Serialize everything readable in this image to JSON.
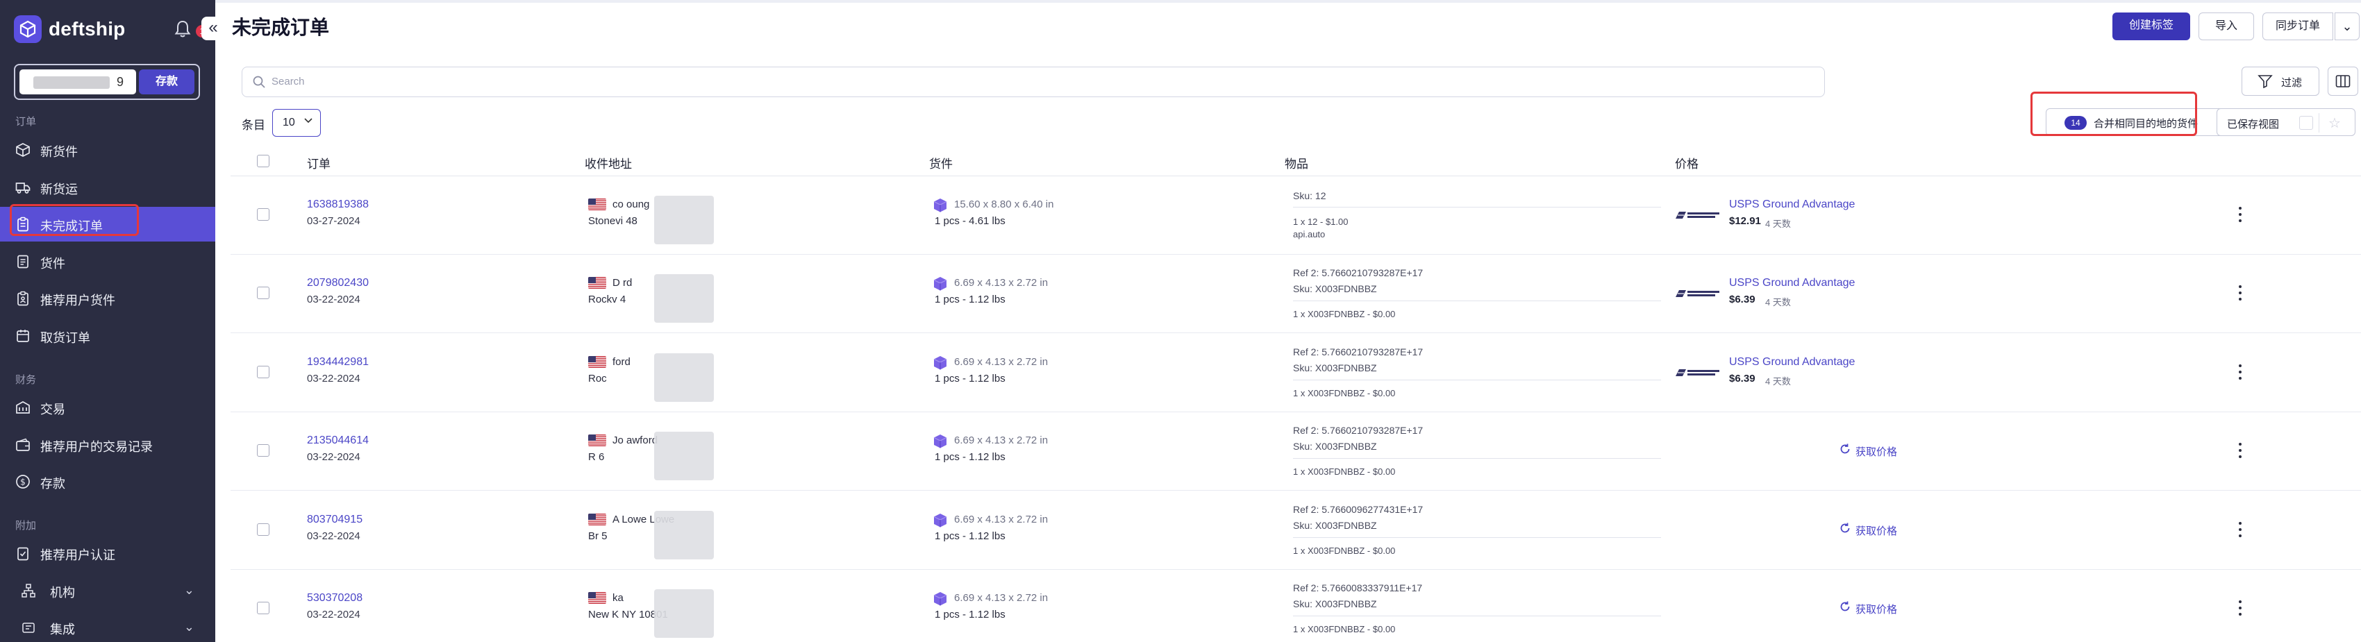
{
  "sidebar": {
    "logo_text": "deftship",
    "notification_count": "13",
    "collapse_glyph": "«",
    "balance_suffix": "9",
    "deposit_label": "存款",
    "section_orders": "订单",
    "section_finance": "财务",
    "section_extra": "附加",
    "items": [
      {
        "label": "新货件",
        "icon": "box-icon"
      },
      {
        "label": "新货运",
        "icon": "truck-icon"
      },
      {
        "label": "未完成订单",
        "icon": "clipboard-icon",
        "active": true
      },
      {
        "label": "货件",
        "icon": "document-icon"
      },
      {
        "label": "推荐用户货件",
        "icon": "clipboard-user-icon"
      },
      {
        "label": "取货订单",
        "icon": "pickup-icon"
      },
      {
        "label": "交易",
        "icon": "exchange-icon"
      },
      {
        "label": "推荐用户的交易记录",
        "icon": "wallet-icon"
      },
      {
        "label": "存款",
        "icon": "dollar-circle-icon"
      },
      {
        "label": "推荐用户认证",
        "icon": "badge-icon"
      },
      {
        "label": "机构",
        "icon": "organization-icon",
        "chevron": "⌄"
      },
      {
        "label": "集成",
        "icon": "integration-icon",
        "chevron": "⌄"
      }
    ]
  },
  "header": {
    "title": "未完成订单",
    "create_label": "创建标签",
    "import_label": "导入",
    "sync_label": "同步订单",
    "more_glyph": "⌄"
  },
  "toolbar": {
    "search_placeholder": "Search",
    "filter_label": "过滤",
    "per_page_label": "条目",
    "per_page_value": "10",
    "merge_count": "14",
    "merge_label": "合并相同目的地的货件",
    "saved_views_label": "已保存视图"
  },
  "table": {
    "columns": [
      "订单",
      "收件地址",
      "货件",
      "物品",
      "价格"
    ],
    "rows": [
      {
        "order_id": "1638819388",
        "date": "03-27-2024",
        "addr_line1": "co        oung",
        "addr_line2": "Stonevi            48",
        "dims": "15.60 x 8.80 x 6.40 in",
        "pcs": "1 pcs - 4.61 lbs",
        "item_lines": [
          "Sku: 12",
          "",
          "1 x 12 - $1.00",
          "api.auto"
        ],
        "carrier": "USPS Ground Advantage",
        "price": "$12.91",
        "days": "4 天数",
        "get_price": ""
      },
      {
        "order_id": "2079802430",
        "date": "03-22-2024",
        "addr_line1": "D              rd",
        "addr_line2": "Rockv        4",
        "dims": "6.69 x 4.13 x 2.72 in",
        "pcs": "1 pcs - 1.12 lbs",
        "item_lines": [
          "Ref 2: 5.7660210793287E+17",
          "Sku: X003FDNBBZ",
          "1 x X003FDNBBZ - $0.00"
        ],
        "carrier": "USPS Ground Advantage",
        "price": "$6.39",
        "days": "4 天数",
        "get_price": ""
      },
      {
        "order_id": "1934442981",
        "date": "03-22-2024",
        "addr_line1": "             ford",
        "addr_line2": "Roc",
        "dims": "6.69 x 4.13 x 2.72 in",
        "pcs": "1 pcs - 1.12 lbs",
        "item_lines": [
          "Ref 2: 5.7660210793287E+17",
          "Sku: X003FDNBBZ",
          "1 x X003FDNBBZ - $0.00"
        ],
        "carrier": "USPS Ground Advantage",
        "price": "$6.39",
        "days": "4 天数",
        "get_price": ""
      },
      {
        "order_id": "2135044614",
        "date": "03-22-2024",
        "addr_line1": "Jo       awford",
        "addr_line2": "R              6",
        "dims": "6.69 x 4.13 x 2.72 in",
        "pcs": "1 pcs - 1.12 lbs",
        "item_lines": [
          "Ref 2: 5.7660210793287E+17",
          "Sku: X003FDNBBZ",
          "1 x X003FDNBBZ - $0.00"
        ],
        "carrier": "",
        "price": "",
        "days": "",
        "get_price": "获取价格"
      },
      {
        "order_id": "803704915",
        "date": "03-22-2024",
        "addr_line1": "A         Lowe Lowe",
        "addr_line2": "Br           5",
        "dims": "6.69 x 4.13 x 2.72 in",
        "pcs": "1 pcs - 1.12 lbs",
        "item_lines": [
          "Ref 2: 5.7660096277431E+17",
          "Sku: X003FDNBBZ",
          "1 x X003FDNBBZ - $0.00"
        ],
        "carrier": "",
        "price": "",
        "days": "",
        "get_price": "获取价格"
      },
      {
        "order_id": "530370208",
        "date": "03-22-2024",
        "addr_line1": "          ka",
        "addr_line2": "New K         NY 10801",
        "dims": "6.69 x 4.13 x 2.72 in",
        "pcs": "1 pcs - 1.12 lbs",
        "item_lines": [
          "Ref 2: 5.7660083337911E+17",
          "Sku: X003FDNBBZ",
          "1 x X003FDNBBZ - $0.00"
        ],
        "carrier": "",
        "price": "",
        "days": "",
        "get_price": "获取价格"
      }
    ]
  },
  "colors": {
    "sidebar_bg": "#2b2d42",
    "accent": "#4b46c7",
    "active_nav": "#5a4fd6",
    "highlight_box": "#e5383b"
  }
}
